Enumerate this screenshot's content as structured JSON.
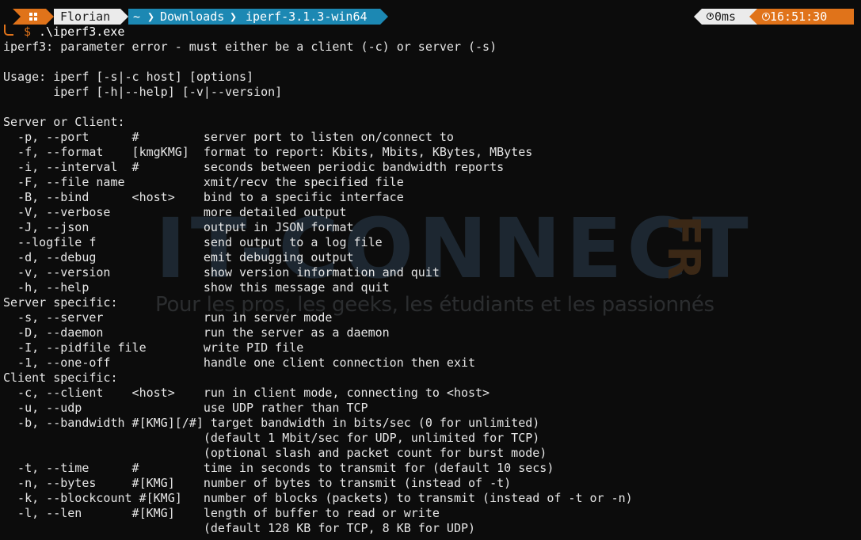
{
  "watermark": {
    "brand": "IT-CONNECT",
    "suffix": "FR",
    "tagline": "Pour les pros, les geeks, les étudiants et les passionnés"
  },
  "prompt": {
    "user": "Florian",
    "path": [
      "~",
      "Downloads",
      "iperf-3.1.3-win64"
    ],
    "exec_time": "0ms",
    "clock": "16:51:30",
    "symbol": "$",
    "command": ".\\iperf3.exe",
    "colors": {
      "accent_orange": "#e0731a",
      "path_blue": "#1c88b3",
      "segment_light": "#ebebeb"
    },
    "icons": [
      "windows-icon",
      "stopwatch-icon",
      "alarm-clock-icon"
    ]
  },
  "output": [
    "iperf3: parameter error - must either be a client (-c) or server (-s)",
    "",
    "Usage: iperf [-s|-c host] [options]",
    "       iperf [-h|--help] [-v|--version]",
    "",
    "Server or Client:",
    "  -p, --port      #         server port to listen on/connect to",
    "  -f, --format    [kmgKMG]  format to report: Kbits, Mbits, KBytes, MBytes",
    "  -i, --interval  #         seconds between periodic bandwidth reports",
    "  -F, --file name           xmit/recv the specified file",
    "  -B, --bind      <host>    bind to a specific interface",
    "  -V, --verbose             more detailed output",
    "  -J, --json                output in JSON format",
    "  --logfile f               send output to a log file",
    "  -d, --debug               emit debugging output",
    "  -v, --version             show version information and quit",
    "  -h, --help                show this message and quit",
    "Server specific:",
    "  -s, --server              run in server mode",
    "  -D, --daemon              run the server as a daemon",
    "  -I, --pidfile file        write PID file",
    "  -1, --one-off             handle one client connection then exit",
    "Client specific:",
    "  -c, --client    <host>    run in client mode, connecting to <host>",
    "  -u, --udp                 use UDP rather than TCP",
    "  -b, --bandwidth #[KMG][/#] target bandwidth in bits/sec (0 for unlimited)",
    "                            (default 1 Mbit/sec for UDP, unlimited for TCP)",
    "                            (optional slash and packet count for burst mode)",
    "  -t, --time      #         time in seconds to transmit for (default 10 secs)",
    "  -n, --bytes     #[KMG]    number of bytes to transmit (instead of -t)",
    "  -k, --blockcount #[KMG]   number of blocks (packets) to transmit (instead of -t or -n)",
    "  -l, --len       #[KMG]    length of buffer to read or write",
    "                            (default 128 KB for TCP, 8 KB for UDP)"
  ]
}
